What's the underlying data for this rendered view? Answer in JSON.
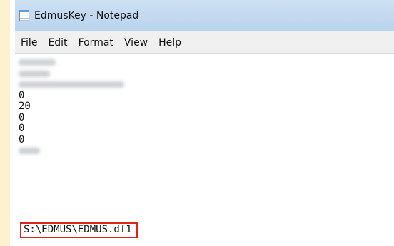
{
  "window": {
    "title": "EdmusKey - Notepad",
    "icon": "notepad-icon"
  },
  "menu": {
    "items": [
      "File",
      "Edit",
      "Format",
      "View",
      "Help"
    ]
  },
  "document": {
    "visible_lines": [
      "0",
      "20",
      "0",
      "0",
      "0"
    ],
    "path_line": "S:\\EDMUS\\EDMUS.df1"
  },
  "colors": {
    "background": "#fdf2cf",
    "highlight_border": "#e0231c"
  }
}
